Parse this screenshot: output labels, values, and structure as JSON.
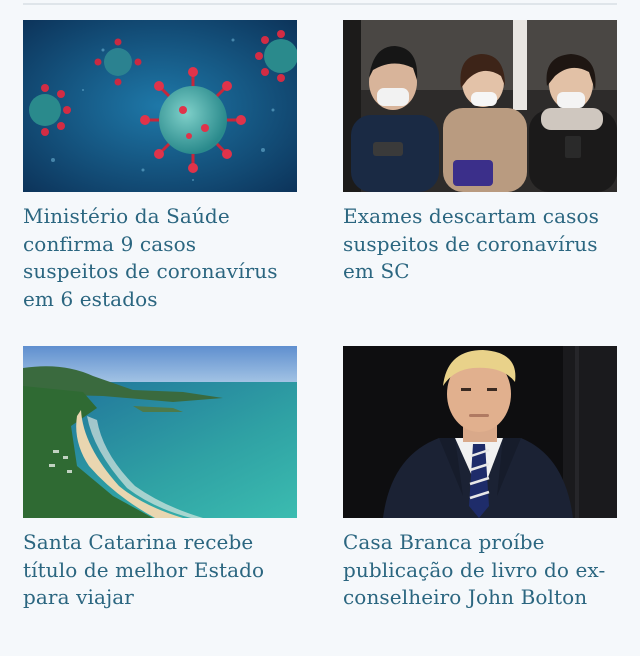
{
  "articles": [
    {
      "headline": "Ministério da Saúde confirma 9 casos suspeitos de coronavírus em 6 estados",
      "image": "coronavirus-illustration"
    },
    {
      "headline": "Exames descartam casos suspeitos de coronavírus em SC",
      "image": "people-wearing-masks-photo"
    },
    {
      "headline": "Santa Catarina recebe título de melhor Estado para viajar",
      "image": "beach-coastline-photo"
    },
    {
      "headline": "Casa Branca proíbe publicação de livro do ex-conselheiro John Bolton",
      "image": "man-in-suit-portrait-photo"
    }
  ],
  "colors": {
    "headline": "#2b6680",
    "background": "#f5f8fb"
  }
}
